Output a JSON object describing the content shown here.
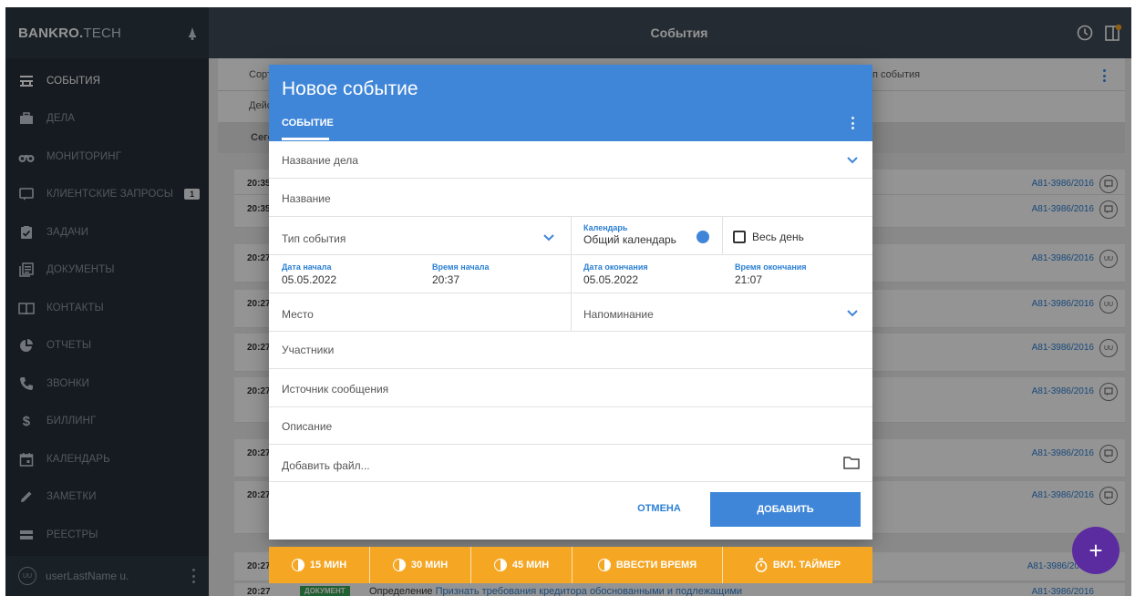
{
  "brand": {
    "name_bold": "BANKRO.",
    "name_light": "TECH"
  },
  "nav": [
    {
      "label": "События",
      "icon": "events-icon",
      "active": true
    },
    {
      "label": "Дела",
      "icon": "briefcase-icon"
    },
    {
      "label": "Мониторинг",
      "icon": "binoculars-icon"
    },
    {
      "label": "Клиентские запросы",
      "icon": "chat-icon",
      "badge": "1"
    },
    {
      "label": "Задачи",
      "icon": "clipboard-check-icon"
    },
    {
      "label": "Документы",
      "icon": "documents-icon"
    },
    {
      "label": "Контакты",
      "icon": "contacts-book-icon"
    },
    {
      "label": "Отчеты",
      "icon": "pie-chart-icon"
    },
    {
      "label": "Звонки",
      "icon": "phone-icon"
    },
    {
      "label": "Биллинг",
      "icon": "dollar-icon"
    },
    {
      "label": "Календарь",
      "icon": "calendar-icon"
    },
    {
      "label": "Заметки",
      "icon": "pencil-icon"
    },
    {
      "label": "Реестры",
      "icon": "registry-icon"
    }
  ],
  "user": {
    "avatar": "UU",
    "name": "userLastName u."
  },
  "topbar": {
    "title": "События"
  },
  "background": {
    "sort_label": "Сорт",
    "actions_label": "Дейс",
    "today_label": "Сего",
    "event_type_label": "п события",
    "rows": [
      {
        "time": "20:35",
        "case": "А81-3986/2016",
        "icon": "chat"
      },
      {
        "time": "20:35",
        "case": "А81-3986/2016",
        "icon": "chat"
      },
      {
        "time": "20:27",
        "case": "А81-3986/2016",
        "icon": "UU"
      },
      {
        "time": "20:27",
        "case": "А81-3986/2016",
        "icon": "UU"
      },
      {
        "time": "20:27",
        "case": "А81-3986/2016",
        "icon": "UU"
      },
      {
        "time": "20:27",
        "case": "А81-3986/2016",
        "icon": "chat"
      },
      {
        "time": "20:27",
        "case": "А81-3986/2016",
        "icon": "chat"
      },
      {
        "time": "20:27",
        "case": "А81-3986/2016",
        "icon": "chat"
      },
      {
        "time": "20:27",
        "case": "А81-3986/20",
        "icon": ""
      }
    ],
    "last_row": {
      "time": "20:27",
      "badge": "ДОКУМЕНТ",
      "text_prefix": "Определение",
      "text_link": "Признать требования кредитора обоснованными и подлежащими",
      "case": "А81-3986/2016"
    }
  },
  "dialog": {
    "title": "Новое событие",
    "tab": "Событие",
    "case_name_placeholder": "Название дела",
    "name_placeholder": "Название",
    "event_type_placeholder": "Тип события",
    "calendar_label": "Календарь",
    "calendar_value": "Общий календарь",
    "all_day_label": "Весь день",
    "start_date_label": "Дата начала",
    "start_date": "05.05.2022",
    "start_time_label": "Время начала",
    "start_time": "20:37",
    "end_date_label": "Дата окончания",
    "end_date": "05.05.2022",
    "end_time_label": "Время окончания",
    "end_time": "21:07",
    "place_placeholder": "Место",
    "reminder_placeholder": "Напоминание",
    "participants_placeholder": "Участники",
    "message_source_placeholder": "Источник сообщения",
    "description_placeholder": "Описание",
    "add_file_placeholder": "Добавить файл...",
    "cancel_label": "Отмена",
    "add_label": "Добавить"
  },
  "timer": {
    "b15": "15 мин",
    "b30": "30 мин",
    "b45": "45 мин",
    "enter_time": "Ввести время",
    "enable_timer": "Вкл. таймер"
  },
  "colors": {
    "accent": "#3f86d8",
    "sidebar": "#26303a",
    "timer": "#f5a623",
    "fab": "#5b2ca0"
  }
}
